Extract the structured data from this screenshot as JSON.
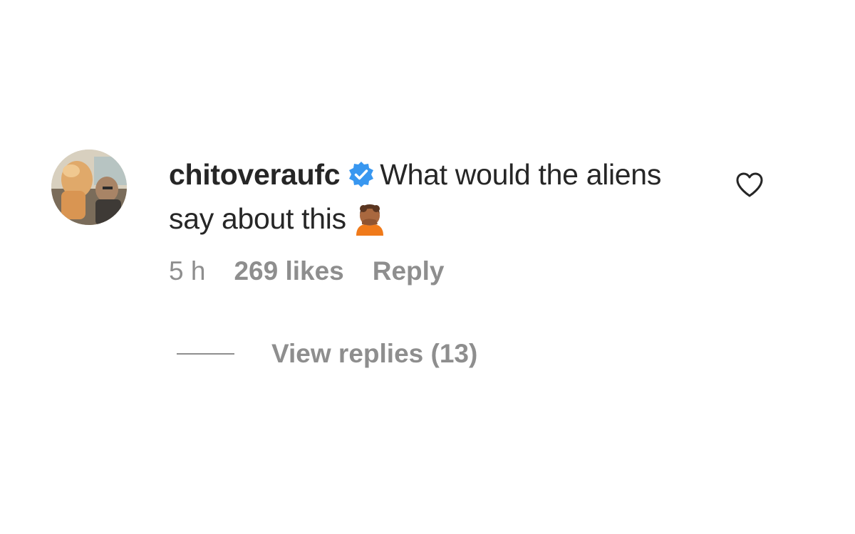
{
  "comment": {
    "username": "chitoveraufc",
    "verified": true,
    "verified_icon": "verified-badge-icon",
    "verified_color": "#3897f0",
    "text": "What would the aliens say about this",
    "emoji_icon": "person-face-palming-emoji",
    "time": "5 h",
    "likes": "269 likes",
    "reply_label": "Reply",
    "like_icon": "heart-outline-icon",
    "view_replies_label": "View replies (13)"
  }
}
